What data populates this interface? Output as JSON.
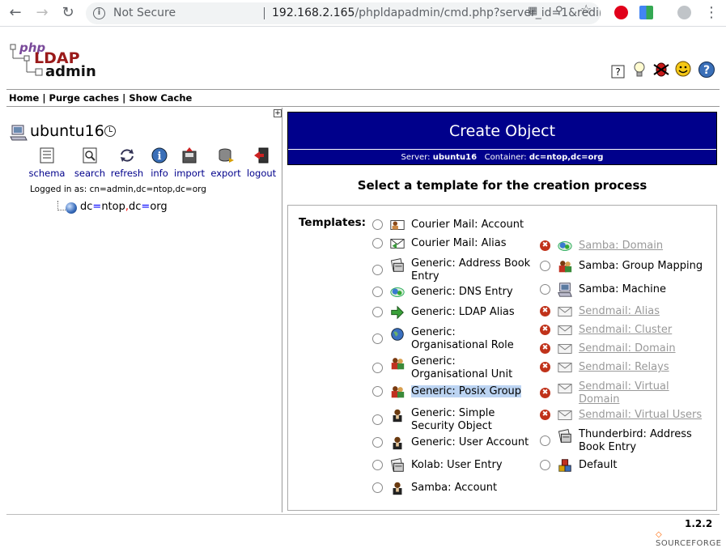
{
  "browser": {
    "security_label": "Not Secure",
    "url_host": "192.168.2.165",
    "url_rest": "/phpldapadmin/cmd.php?server_id=1&redirect=..."
  },
  "logo": {
    "php": "php",
    "ldap": "LDAP",
    "admin": "admin"
  },
  "menu": {
    "home": "Home",
    "sep": "|",
    "purge": "Purge caches",
    "show": "Show Cache"
  },
  "server": {
    "name": "ubuntu16",
    "actions": [
      {
        "label": "schema",
        "icon": "schema-icon"
      },
      {
        "label": "search",
        "icon": "search-icon"
      },
      {
        "label": "refresh",
        "icon": "refresh-icon"
      },
      {
        "label": "info",
        "icon": "info-icon"
      },
      {
        "label": "import",
        "icon": "import-icon"
      },
      {
        "label": "export",
        "icon": "export-icon"
      },
      {
        "label": "logout",
        "icon": "logout-icon"
      }
    ],
    "logged_in": "Logged in as: cn=admin,dc=ntop,dc=org",
    "tree_entry": {
      "p1": "dc",
      "eq1": "=",
      "p2": "ntop",
      "comma": ",",
      "p3": "dc",
      "eq2": "=",
      "p4": "org"
    }
  },
  "main": {
    "title": "Create Object",
    "server_label": "Server:",
    "server_value": "ubuntu16",
    "container_label": "Container:",
    "container_value": "dc=ntop,dc=org",
    "heading": "Select a template for the creation process",
    "templates_label": "Templates:",
    "left_templates": [
      {
        "label": "Courier Mail: Account",
        "icon": "mail-account-icon"
      },
      {
        "label": "Courier Mail: Alias",
        "icon": "mail-alias-icon"
      },
      {
        "label": "Generic: Address Book Entry",
        "icon": "address-book-icon"
      },
      {
        "label": "Generic: DNS Entry",
        "icon": "dns-icon"
      },
      {
        "label": "Generic: LDAP Alias",
        "icon": "green-arrow-icon"
      },
      {
        "label": "Generic: Organisational Role",
        "icon": "globe-icon"
      },
      {
        "label": "Generic: Organisational Unit",
        "icon": "users-icon"
      },
      {
        "label": "Generic: Posix Group",
        "icon": "users-icon"
      },
      {
        "label": "Generic: Simple Security Object",
        "icon": "user-icon"
      },
      {
        "label": "Generic: User Account",
        "icon": "user-icon"
      },
      {
        "label": "Kolab: User Entry",
        "icon": "address-book-icon"
      },
      {
        "label": "Samba: Account",
        "icon": "user-icon"
      }
    ],
    "right_templates": [
      {
        "label": "Samba: Domain",
        "icon": "dns-icon",
        "disabled": true
      },
      {
        "label": "Samba: Group Mapping",
        "icon": "users-icon",
        "disabled": false
      },
      {
        "label": "Samba: Machine",
        "icon": "computer-icon",
        "disabled": false
      },
      {
        "label": "Sendmail: Alias",
        "icon": "envelope-icon",
        "disabled": true
      },
      {
        "label": "Sendmail: Cluster",
        "icon": "envelope-icon",
        "disabled": true
      },
      {
        "label": "Sendmail: Domain",
        "icon": "envelope-icon",
        "disabled": true
      },
      {
        "label": "Sendmail: Relays",
        "icon": "envelope-icon",
        "disabled": true
      },
      {
        "label": "Sendmail: Virtual Domain",
        "icon": "envelope-icon",
        "disabled": true
      },
      {
        "label": "Sendmail: Virtual Users",
        "icon": "envelope-icon",
        "disabled": true
      },
      {
        "label": "Thunderbird: Address Book Entry",
        "icon": "address-book-icon",
        "disabled": false
      },
      {
        "label": "Default",
        "icon": "default-objects-icon",
        "disabled": false
      }
    ]
  },
  "footer": {
    "version": "1.2.2",
    "sourceforge": "SOURCEFORGE"
  }
}
